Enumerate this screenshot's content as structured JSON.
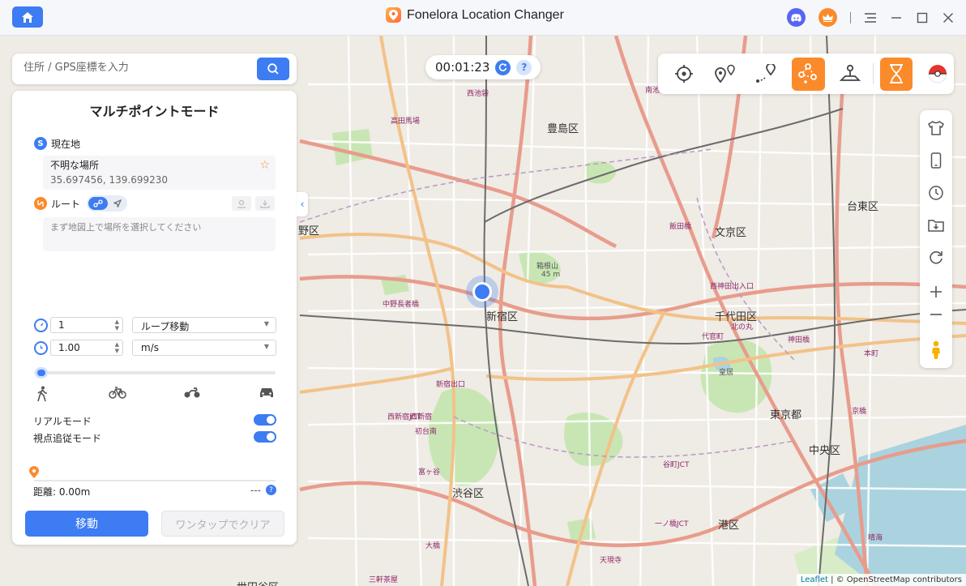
{
  "app": {
    "title": "Fonelora Location Changer"
  },
  "titlebar": {
    "icons": [
      "home-icon",
      "discord-icon",
      "crown-icon",
      "menu-icon",
      "minimize-icon",
      "maximize-icon",
      "close-icon"
    ]
  },
  "timer": {
    "value": "00:01:23",
    "help": "?"
  },
  "search": {
    "placeholder": "住所 / GPS座標を入力"
  },
  "panel": {
    "title": "マルチポイントモード",
    "current_badge": "S",
    "current_label": "現在地",
    "location_name": "不明な場所",
    "location_coords": "35.697456, 139.699230",
    "route_label": "ルート",
    "route_placeholder": "まず地図上で場所を選択してください",
    "loop_count": "1",
    "loop_mode": "ループ移動",
    "speed_value": "1.00",
    "speed_unit": "m/s",
    "real_mode_label": "リアルモード",
    "view_follow_label": "視点追従モード",
    "distance_label": "距離: 0.00m",
    "eta": "---",
    "help": "?",
    "move_button": "移動",
    "clear_button": "ワンタップでクリア"
  },
  "map": {
    "labels": [
      {
        "t": "豊島区"
      },
      {
        "t": "文京区"
      },
      {
        "t": "台東区"
      },
      {
        "t": "新宿区"
      },
      {
        "t": "千代田区"
      },
      {
        "t": "東京都"
      },
      {
        "t": "中央区"
      },
      {
        "t": "渋谷区"
      },
      {
        "t": "港区"
      },
      {
        "t": "野区"
      },
      {
        "t": "箱根山"
      },
      {
        "t": "45 m"
      },
      {
        "t": "西池袋"
      },
      {
        "t": "西新宿"
      },
      {
        "t": "初台南"
      },
      {
        "t": "富ヶ谷"
      },
      {
        "t": "中野長者橋"
      },
      {
        "t": "飯田橋"
      },
      {
        "t": "西神田出入口"
      },
      {
        "t": "北の丸"
      },
      {
        "t": "皇居"
      },
      {
        "t": "代官町"
      },
      {
        "t": "神田橋"
      },
      {
        "t": "本町"
      },
      {
        "t": "京橋"
      },
      {
        "t": "晴海"
      },
      {
        "t": "大橋"
      },
      {
        "t": "三軒茶屋"
      },
      {
        "t": "世田谷区"
      },
      {
        "t": "西新宿JCT"
      },
      {
        "t": "谷町JCT"
      },
      {
        "t": "一ノ橋JCT"
      },
      {
        "t": "天現寺"
      },
      {
        "t": "南池袋"
      },
      {
        "t": "高田馬場"
      },
      {
        "t": "新宿出口"
      }
    ]
  },
  "attribution": {
    "leaflet": "Leaflet",
    "rest": " | © OpenStreetMap contributors"
  },
  "colors": {
    "accent": "#3d7cf2",
    "orange": "#fb8a2b"
  }
}
